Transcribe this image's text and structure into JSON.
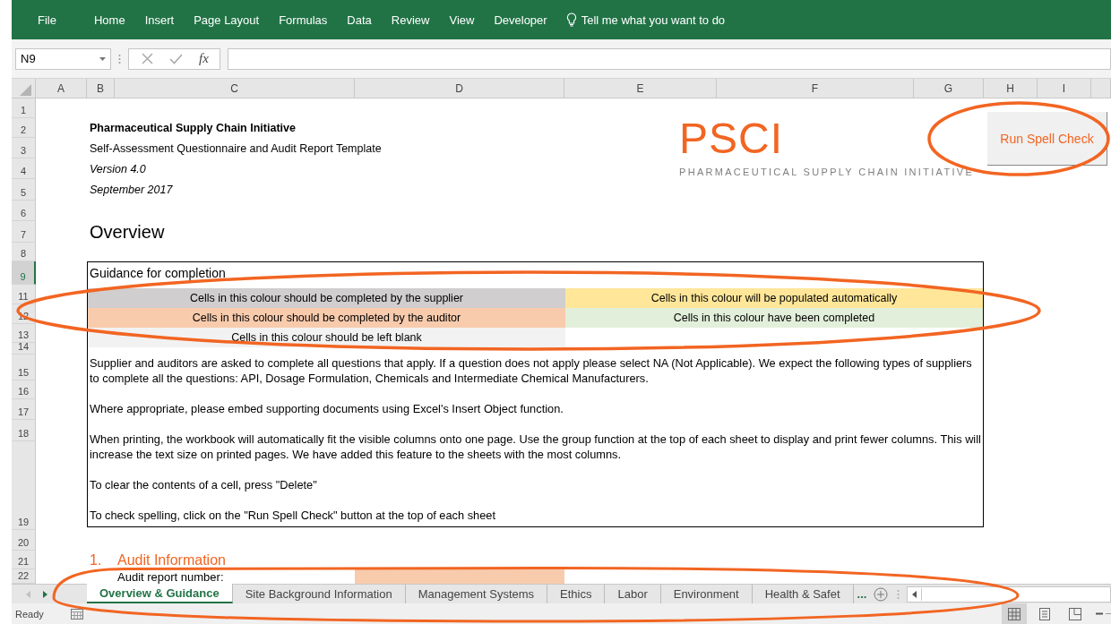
{
  "ribbon": {
    "tabs": [
      {
        "label": "File"
      },
      {
        "label": "Home"
      },
      {
        "label": "Insert"
      },
      {
        "label": "Page Layout"
      },
      {
        "label": "Formulas"
      },
      {
        "label": "Data"
      },
      {
        "label": "Review"
      },
      {
        "label": "View"
      },
      {
        "label": "Developer"
      }
    ],
    "tell_me": "Tell me what you want to do"
  },
  "formula_bar": {
    "name_box": "N9",
    "function_label": "fx"
  },
  "columns": [
    "A",
    "B",
    "C",
    "D",
    "E",
    "F",
    "G",
    "H",
    "I"
  ],
  "rows": [
    {
      "label": "1",
      "selected": false
    },
    {
      "label": "2",
      "selected": false
    },
    {
      "label": "3",
      "selected": false
    },
    {
      "label": "4",
      "selected": false
    },
    {
      "label": "5",
      "selected": false
    },
    {
      "label": "6",
      "selected": false
    },
    {
      "label": "7",
      "selected": false
    },
    {
      "label": "8",
      "selected": false
    },
    {
      "label": "9",
      "selected": true
    },
    {
      "label": "11",
      "selected": false
    },
    {
      "label": "12",
      "selected": false
    },
    {
      "label": "13",
      "selected": false
    },
    {
      "label": "14",
      "selected": false
    },
    {
      "label": "15",
      "selected": false
    },
    {
      "label": "16",
      "selected": false
    },
    {
      "label": "17",
      "selected": false
    },
    {
      "label": "18",
      "selected": false
    },
    {
      "label": "19",
      "selected": false
    },
    {
      "label": "20",
      "selected": false
    },
    {
      "label": "21",
      "selected": false
    },
    {
      "label": "22",
      "selected": false
    }
  ],
  "header": {
    "title": "Pharmaceutical Supply Chain Initiative",
    "subtitle": "Self-Assessment Questionnaire and Audit Report Template",
    "version": "Version 4.0",
    "date": "September 2017"
  },
  "logo": {
    "mark": "PSCI",
    "tagline": "PHARMACEUTICAL SUPPLY CHAIN INITIATIVE"
  },
  "spell_check_button": "Run Spell Check",
  "section_title": "Overview",
  "guidance": {
    "title": "Guidance for completion",
    "legend": [
      {
        "text": "Cells in this colour should be completed by the supplier",
        "color": "#d0cece"
      },
      {
        "text": "Cells in this colour will be populated automatically",
        "color": "#ffe699"
      },
      {
        "text": "Cells in this colour should be completed by the auditor",
        "color": "#f8cbad"
      },
      {
        "text": "Cells in this colour have been completed",
        "color": "#e2efda"
      },
      {
        "text": "Cells in this colour should be left blank",
        "color": "#f2f2f2"
      }
    ],
    "paragraphs": [
      "Supplier and auditors are asked to complete all questions that apply. If a question does not apply please select NA (Not Applicable). We expect the following types of suppliers to complete all the questions: API, Dosage Formulation, Chemicals and Intermediate Chemical Manufacturers.",
      "Where appropriate, please embed supporting documents using Excel's Insert Object function.",
      "When printing, the workbook will automatically fit the visible columns onto one page. Use the group function at the top of each sheet to display and print fewer columns. This will increase the text size on printed pages. We have added this feature to the sheets with the most columns.",
      "To clear the contents of a cell, press \"Delete\"",
      "To check spelling, click on the \"Run Spell Check\" button at the top of each sheet"
    ]
  },
  "audit": {
    "number": "1.",
    "title": "Audit Information",
    "field_label": "Audit report number:"
  },
  "sheet_tabs": [
    {
      "label": "Overview & Guidance",
      "selected": true
    },
    {
      "label": "Site Background Information",
      "selected": false
    },
    {
      "label": "Management Systems",
      "selected": false
    },
    {
      "label": "Ethics",
      "selected": false
    },
    {
      "label": "Labor",
      "selected": false
    },
    {
      "label": "Environment",
      "selected": false
    },
    {
      "label": "Health & Safet",
      "selected": false
    }
  ],
  "more_tabs": "...",
  "status": "Ready",
  "view_modes": [
    {
      "kind": "normal",
      "selected": true
    },
    {
      "kind": "page_layout",
      "selected": false
    },
    {
      "kind": "page_break",
      "selected": false
    }
  ]
}
